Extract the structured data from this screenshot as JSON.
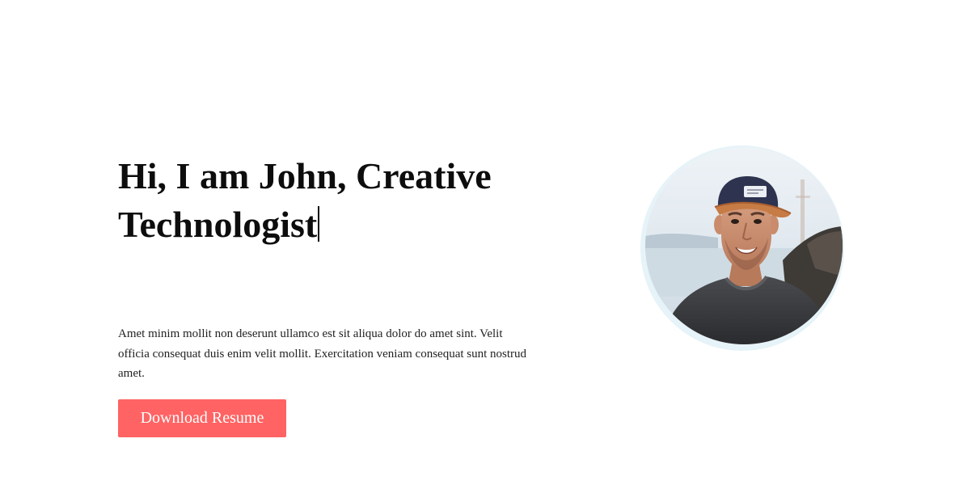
{
  "hero": {
    "title": "Hi, I am John, Creative Technologist",
    "description": "Amet minim mollit non deserunt ullamco est sit aliqua dolor do amet sint. Velit officia consequat duis enim velit mollit. Exercitation veniam consequat sunt nostrud amet.",
    "button_label": "Download Resume",
    "avatar_icon": "portrait-photo"
  },
  "colors": {
    "accent": "#ff6363",
    "avatar_ring": "#e6f3f8",
    "text": "#0d0d0d",
    "background": "#ffffff"
  }
}
